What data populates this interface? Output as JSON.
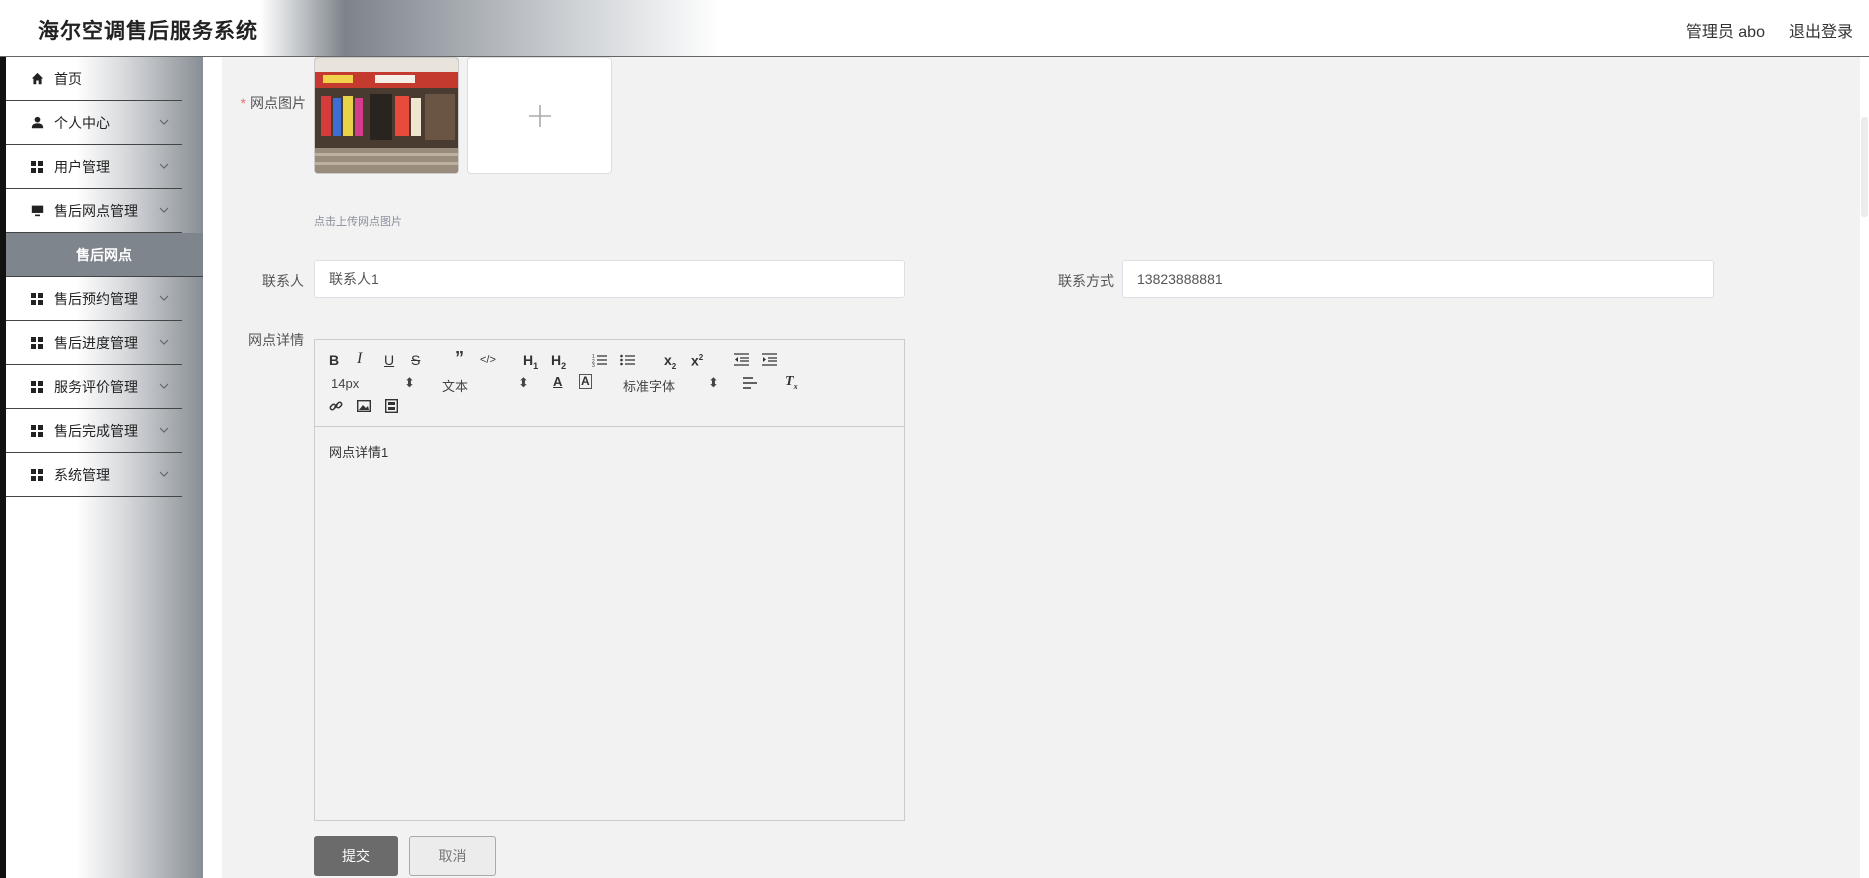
{
  "header": {
    "title": "海尔空调售后服务系统",
    "user": "管理员 abo",
    "logout": "退出登录"
  },
  "sidebar": {
    "items": [
      {
        "label": "首页",
        "icon": "home-icon"
      },
      {
        "label": "个人中心",
        "icon": "person-icon"
      },
      {
        "label": "用户管理",
        "icon": "grid-icon"
      },
      {
        "label": "售后网点管理",
        "icon": "monitor-icon"
      },
      {
        "label": "售后网点",
        "icon": ""
      },
      {
        "label": "售后预约管理",
        "icon": "grid-icon"
      },
      {
        "label": "售后进度管理",
        "icon": "grid-icon"
      },
      {
        "label": "服务评价管理",
        "icon": "grid-icon"
      },
      {
        "label": "售后完成管理",
        "icon": "grid-icon"
      },
      {
        "label": "系统管理",
        "icon": "grid-icon"
      }
    ]
  },
  "form": {
    "image_label": "网点图片",
    "upload_hint": "点击上传网点图片",
    "contact_label": "联系人",
    "contact_value": "联系人1",
    "phone_label": "联系方式",
    "phone_value": "13823888881",
    "detail_label": "网点详情",
    "submit": "提交",
    "cancel": "取消"
  },
  "editor": {
    "font_size": "14px",
    "header_picker": "文本",
    "font_family": "标准字体",
    "content": "网点详情1"
  }
}
